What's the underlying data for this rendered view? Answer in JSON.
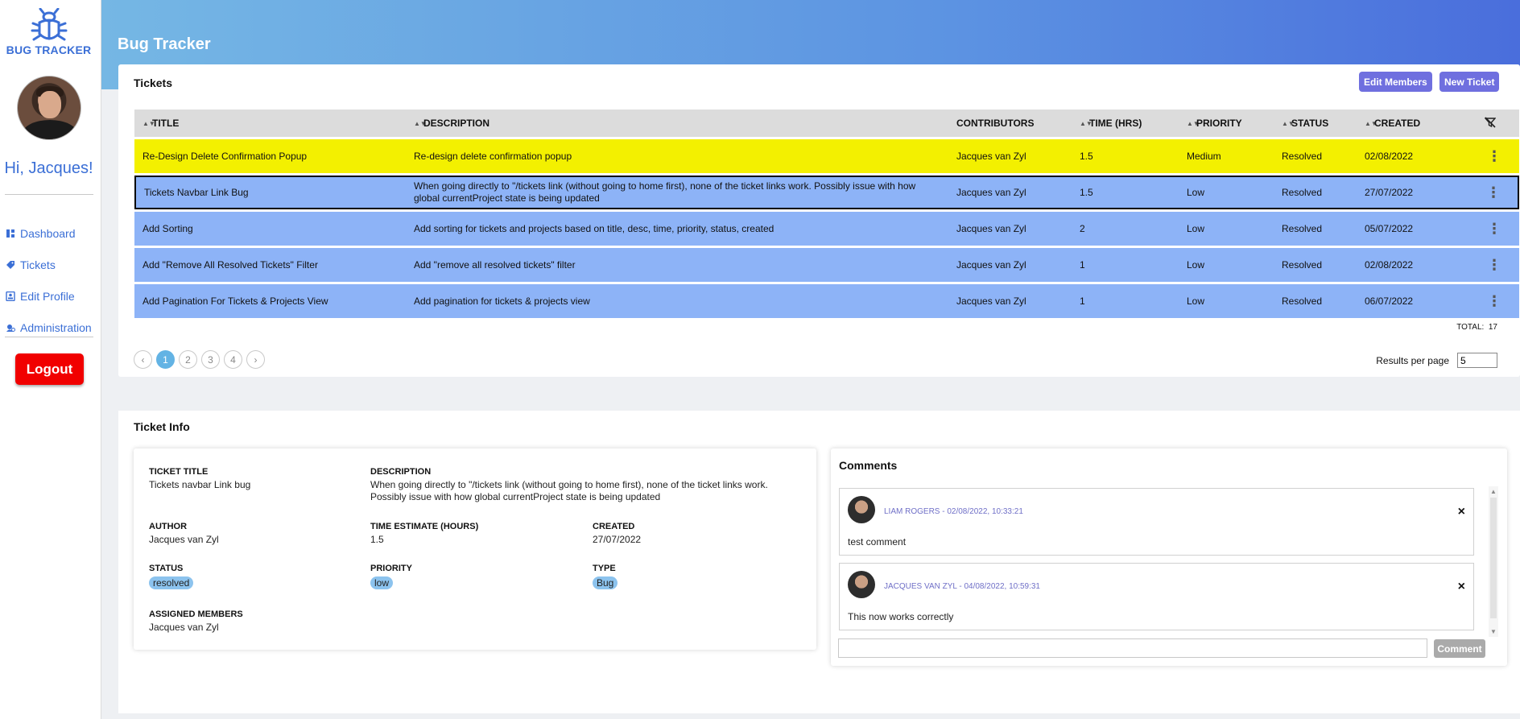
{
  "app": {
    "logo_text": "BUG TRACKER",
    "greeting": "Hi, Jacques!",
    "header_title": "Bug Tracker"
  },
  "sidebar": {
    "items": [
      {
        "label": "Dashboard",
        "icon": "dashboard-icon"
      },
      {
        "label": "Tickets",
        "icon": "ticket-icon"
      },
      {
        "label": "Edit Profile",
        "icon": "profile-icon"
      },
      {
        "label": "Administration",
        "icon": "admin-icon"
      }
    ],
    "logout_label": "Logout"
  },
  "tickets": {
    "title": "Tickets",
    "edit_members_label": "Edit Members",
    "new_ticket_label": "New Ticket",
    "columns": [
      "TITLE",
      "DESCRIPTION",
      "CONTRIBUTORS",
      "TIME (HRS)",
      "PRIORITY",
      "STATUS",
      "CREATED"
    ],
    "rows": [
      {
        "title": "Re-Design Delete Confirmation Popup",
        "description": "Re-design delete confirmation popup",
        "contributors": "Jacques van Zyl",
        "time": "1.5",
        "priority": "Medium",
        "status": "Resolved",
        "created": "02/08/2022",
        "color": "#f3f000"
      },
      {
        "title": "Tickets Navbar Link Bug",
        "description": "When going directly to \"/tickets link (without going to home first), none of the ticket links work. Possibly issue with how global currentProject state is being updated",
        "contributors": "Jacques van Zyl",
        "time": "1.5",
        "priority": "Low",
        "status": "Resolved",
        "created": "27/07/2022",
        "color": "#8db3f7"
      },
      {
        "title": "Add Sorting",
        "description": "Add sorting for tickets and projects based on title, desc, time, priority, status, created",
        "contributors": "Jacques van Zyl",
        "time": "2",
        "priority": "Low",
        "status": "Resolved",
        "created": "05/07/2022",
        "color": "#8db3f7"
      },
      {
        "title": "Add \"Remove All Resolved Tickets\" Filter",
        "description": "Add \"remove all resolved tickets\" filter",
        "contributors": "Jacques van Zyl",
        "time": "1",
        "priority": "Low",
        "status": "Resolved",
        "created": "02/08/2022",
        "color": "#8db3f7"
      },
      {
        "title": "Add Pagination For Tickets & Projects View",
        "description": "Add pagination for tickets & projects view",
        "contributors": "Jacques van Zyl",
        "time": "1",
        "priority": "Low",
        "status": "Resolved",
        "created": "06/07/2022",
        "color": "#8db3f7"
      }
    ],
    "total_label": "TOTAL:",
    "total_value": "17",
    "pages": [
      "1",
      "2",
      "3",
      "4"
    ],
    "current_page": "1",
    "results_per_page_label": "Results per page",
    "results_per_page_value": "5"
  },
  "ticket_info": {
    "title": "Ticket Info",
    "ticket_title_label": "TICKET TITLE",
    "ticket_title_value": "Tickets navbar Link bug",
    "description_label": "DESCRIPTION",
    "description_value": "When going directly to \"/tickets link (without going to home first), none of the ticket links work. Possibly issue with how global currentProject state is being updated",
    "author_label": "AUTHOR",
    "author_value": "Jacques van Zyl",
    "time_label": "TIME ESTIMATE (HOURS)",
    "time_value": "1.5",
    "created_label": "CREATED",
    "created_value": "27/07/2022",
    "status_label": "STATUS",
    "status_value": "resolved",
    "priority_label": "PRIORITY",
    "priority_value": "low",
    "type_label": "TYPE",
    "type_value": "Bug",
    "assigned_label": "ASSIGNED MEMBERS",
    "assigned_value": "Jacques van Zyl"
  },
  "comments": {
    "title": "Comments",
    "items": [
      {
        "meta": "LIAM ROGERS - 02/08/2022, 10:33:21",
        "text": "test comment"
      },
      {
        "meta": "JACQUES VAN ZYL - 04/08/2022, 10:59:31",
        "text": "This now works correctly"
      }
    ],
    "button_label": "Comment",
    "input_value": ""
  },
  "colors": {
    "accent": "#3b6fd6",
    "header_gradient_start": "#75b7e4",
    "header_gradient_end": "#4a6edc",
    "button_purple": "#6f6fdf",
    "logout_red": "#f10000",
    "row_highlight_yellow": "#f3f000",
    "row_blue": "#8db3f7"
  }
}
